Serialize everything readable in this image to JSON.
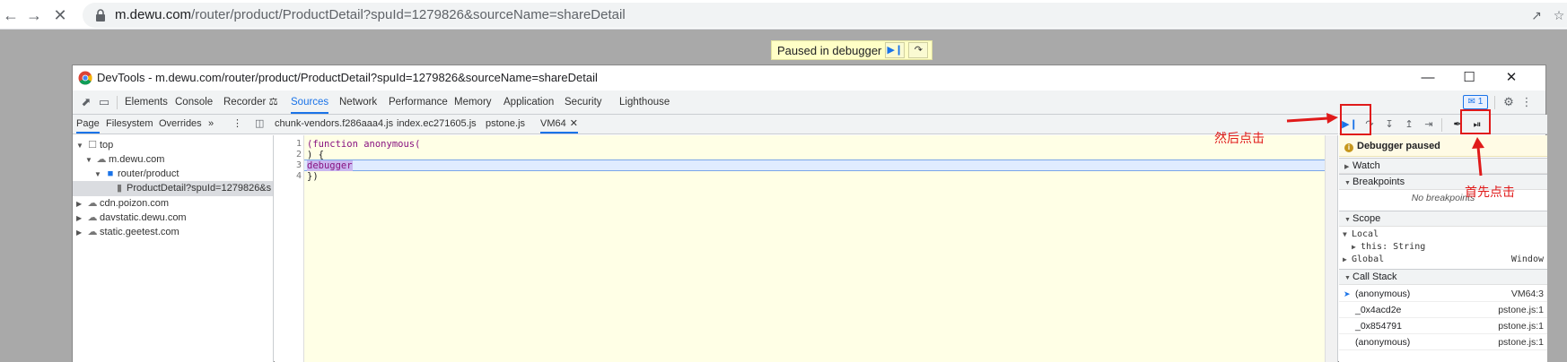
{
  "browser": {
    "url_host": "m.dewu.com",
    "url_path": "/router/product/ProductDetail?spuId=1279826&sourceName=shareDetail"
  },
  "page": {
    "paused_banner": "Paused in debugger"
  },
  "devtools": {
    "window_title": "DevTools - m.dewu.com/router/product/ProductDetail?spuId=1279826&sourceName=shareDetail",
    "main_tabs": [
      "Elements",
      "Console",
      "Recorder ⚖",
      "Sources",
      "Network",
      "Performance",
      "Memory",
      "Application",
      "Security",
      "Lighthouse"
    ],
    "active_main_tab": "Sources",
    "message_badge": "1",
    "navigator_tabs": [
      "Page",
      "Filesystem",
      "Overrides",
      "»"
    ],
    "file_tabs": [
      "chunk-vendors.f286aaa4.js",
      "index.ec271605.js",
      "pstone.js",
      "VM64"
    ],
    "active_file_tab": "VM64",
    "tree": {
      "top": "top",
      "host": "m.dewu.com",
      "folder": "router/product",
      "file": "ProductDetail?spuId=1279826&s",
      "others": [
        "cdn.poizon.com",
        "davstatic.dewu.com",
        "static.geetest.com"
      ]
    },
    "code": {
      "line_numbers": [
        "1",
        "2",
        "3",
        "4"
      ],
      "line1": "(function anonymous(",
      "line2": ") {",
      "line3": "debugger",
      "line4": "})"
    },
    "sidebar": {
      "paused_message": "Debugger paused",
      "watch": "Watch",
      "breakpoints": "Breakpoints",
      "no_breakpoints": "No breakpoints",
      "scope": "Scope",
      "local": "Local",
      "this_label": "this: String",
      "global": "Global",
      "global_value": "Window",
      "call_stack": "Call Stack",
      "frames": [
        {
          "fn": "(anonymous)",
          "loc": "VM64:3"
        },
        {
          "fn": "_0x4acd2e",
          "loc": "pstone.js:1"
        },
        {
          "fn": "_0x854791",
          "loc": "pstone.js:1"
        },
        {
          "fn": "(anonymous)",
          "loc": "pstone.js:1"
        }
      ]
    }
  },
  "annotations": {
    "then_click": "然后点击",
    "first_click": "首先点击"
  },
  "colors": {
    "accent": "#1a73e8",
    "annotation_red": "#e01a1a",
    "editor_bg": "#ffffe6"
  }
}
